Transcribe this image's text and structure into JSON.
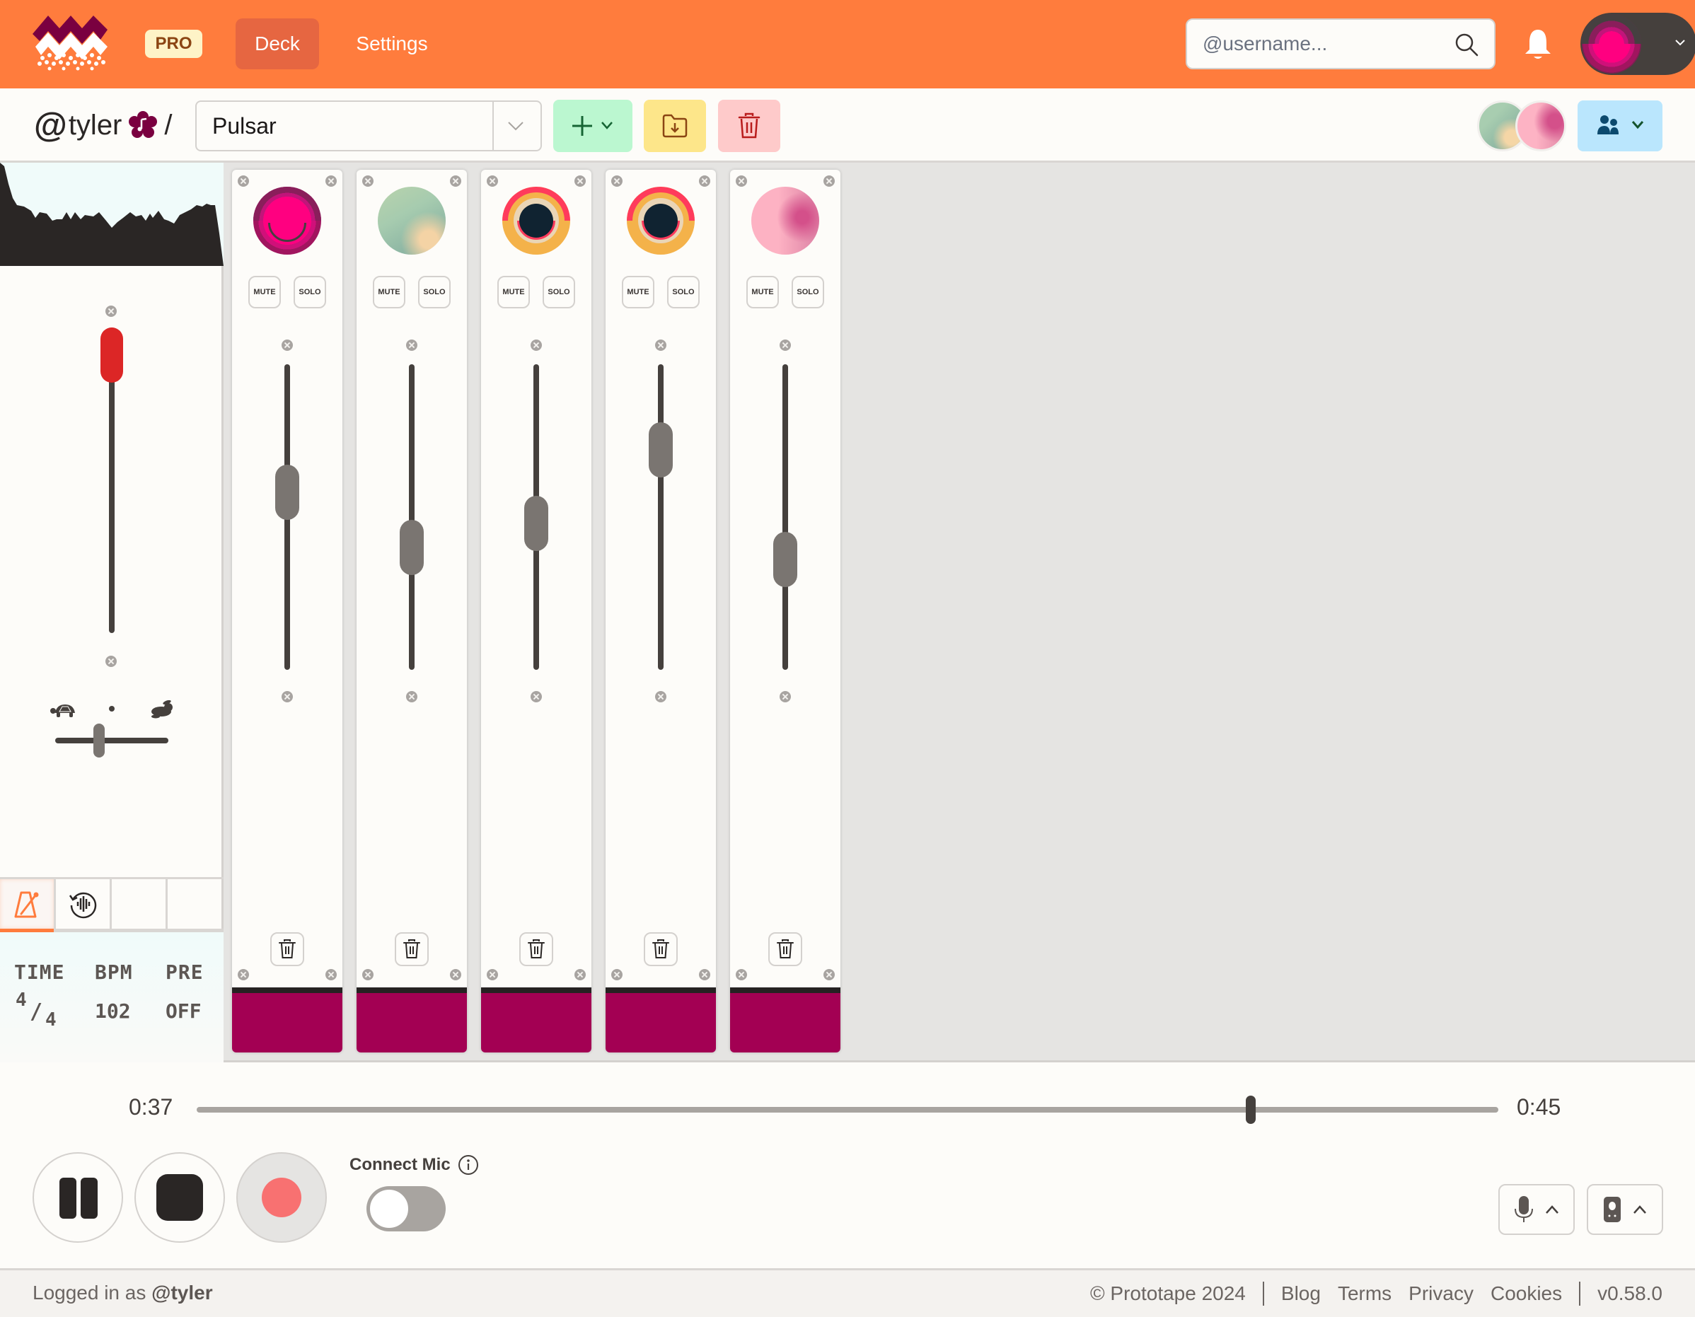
{
  "header": {
    "logo": "prototape-logo",
    "badge": "PRO",
    "nav": [
      {
        "label": "Deck",
        "active": true
      },
      {
        "label": "Settings",
        "active": false
      }
    ],
    "search": {
      "placeholder": "@username...",
      "value": ""
    },
    "icons": {
      "search": "search-icon",
      "notifications": "bell-icon",
      "account_menu": "chevron-down-icon"
    }
  },
  "subbar": {
    "owner_at": "@",
    "owner_name": "tyler",
    "owner_badge": "flower-music-icon",
    "separator": "/",
    "project": {
      "value": "Pulsar"
    },
    "buttons": {
      "add": "plus-icon",
      "import": "folder-download-icon",
      "delete": "trash-icon",
      "share": "users-icon"
    },
    "collaborator_count": 2
  },
  "master": {
    "volume": 0.91,
    "speed": 0.39,
    "speed_icons": {
      "slow": "turtle-icon",
      "fast": "rabbit-icon"
    },
    "tools": [
      {
        "name": "metronome",
        "active": true
      },
      {
        "name": "loop-audio",
        "active": false
      },
      {
        "name": "empty",
        "active": false
      },
      {
        "name": "empty",
        "active": false
      }
    ],
    "metronome": {
      "time_label": "TIME",
      "time_num": "4",
      "time_slash": "/",
      "time_den": "4",
      "bpm_label": "BPM",
      "bpm_value": "102",
      "pre_label": "PRE",
      "pre_value": "OFF"
    }
  },
  "tracks": [
    {
      "art": "pink",
      "mute_label": "MUTE",
      "solo_label": "SOLO",
      "volume": 0.58,
      "color": "#A30053"
    },
    {
      "art": "green",
      "mute_label": "MUTE",
      "solo_label": "SOLO",
      "volume": 0.4,
      "color": "#A30053"
    },
    {
      "art": "eye",
      "mute_label": "MUTE",
      "solo_label": "SOLO",
      "volume": 0.48,
      "color": "#A30053"
    },
    {
      "art": "eye",
      "mute_label": "MUTE",
      "solo_label": "SOLO",
      "volume": 0.72,
      "color": "#A30053"
    },
    {
      "art": "rose",
      "mute_label": "MUTE",
      "solo_label": "SOLO",
      "volume": 0.36,
      "color": "#A30053"
    }
  ],
  "transport": {
    "current_time": "0:37",
    "total_time": "0:45",
    "progress": 0.81,
    "connect_mic_label": "Connect Mic",
    "mic_connected": false
  },
  "footer": {
    "logged_in_prefix": "Logged in as",
    "logged_in_user": "@tyler",
    "copyright": "© Prototape 2024",
    "links": [
      "Blog",
      "Terms",
      "Privacy",
      "Cookies"
    ],
    "version": "v0.58.0"
  },
  "colors": {
    "brand": "#FF7C3D",
    "nav_active": "#E66641",
    "track_color": "#A30053",
    "master_fader": "#DC2626",
    "record": "#F87171"
  }
}
